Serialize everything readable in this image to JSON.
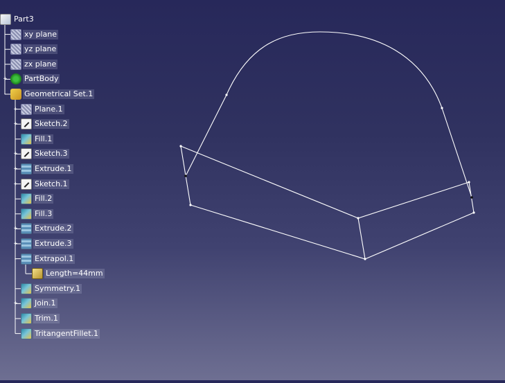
{
  "tree": {
    "nodes": [
      {
        "label": "Part3",
        "icon": "part-icon",
        "level": 0
      },
      {
        "label": "xy plane",
        "icon": "plane-icon",
        "level": 1
      },
      {
        "label": "yz plane",
        "icon": "plane-icon",
        "level": 1
      },
      {
        "label": "zx plane",
        "icon": "plane-icon",
        "level": 1
      },
      {
        "label": "PartBody",
        "icon": "body-icon",
        "level": 1,
        "expander": "+"
      },
      {
        "label": "Geometrical Set.1",
        "icon": "geometrical-set-icon",
        "level": 1,
        "expander": "-"
      },
      {
        "label": "Plane.1",
        "icon": "plane-icon",
        "level": 2,
        "expander": "+"
      },
      {
        "label": "Sketch.2",
        "icon": "sketch-icon",
        "level": 2,
        "expander": "+"
      },
      {
        "label": "Fill.1",
        "icon": "surface-icon",
        "level": 2
      },
      {
        "label": "Sketch.3",
        "icon": "sketch-icon",
        "level": 2,
        "expander": "+"
      },
      {
        "label": "Extrude.1",
        "icon": "extrude-icon",
        "level": 2,
        "expander": "+"
      },
      {
        "label": "Sketch.1",
        "icon": "sketch-icon",
        "level": 2,
        "expander": "+"
      },
      {
        "label": "Fill.2",
        "icon": "surface-icon",
        "level": 2
      },
      {
        "label": "Fill.3",
        "icon": "surface-icon",
        "level": 2
      },
      {
        "label": "Extrude.2",
        "icon": "extrude-icon",
        "level": 2,
        "expander": "+"
      },
      {
        "label": "Extrude.3",
        "icon": "extrude-icon",
        "level": 2,
        "expander": "+"
      },
      {
        "label": "Extrapol.1",
        "icon": "extrude-icon",
        "level": 2,
        "expander": "-"
      },
      {
        "label": "Length=44mm",
        "icon": "parameter-icon",
        "level": 3
      },
      {
        "label": "Symmetry.1",
        "icon": "surface-icon",
        "level": 2
      },
      {
        "label": "Join.1",
        "icon": "surface-icon",
        "level": 2,
        "expander": "+"
      },
      {
        "label": "Trim.1",
        "icon": "surface-icon",
        "level": 2
      },
      {
        "label": "TritangentFillet.1",
        "icon": "surface-icon",
        "level": 2
      }
    ]
  },
  "colors": {
    "background_top": "#27285a",
    "background_bottom": "#6e6f92",
    "geometry": "#ffffff"
  }
}
